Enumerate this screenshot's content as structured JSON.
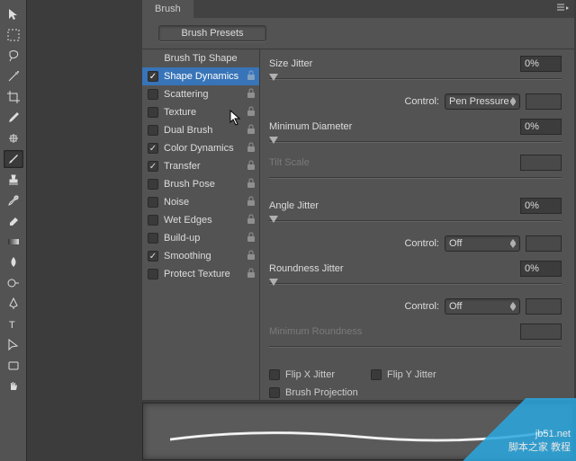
{
  "panel": {
    "title": "Brush",
    "presets_btn": "Brush Presets",
    "tip_shape": "Brush Tip Shape"
  },
  "list": [
    {
      "label": "Shape Dynamics",
      "checked": true,
      "selected": true,
      "lock": true
    },
    {
      "label": "Scattering",
      "checked": false,
      "selected": false,
      "lock": true
    },
    {
      "label": "Texture",
      "checked": false,
      "selected": false,
      "lock": true
    },
    {
      "label": "Dual Brush",
      "checked": false,
      "selected": false,
      "lock": true
    },
    {
      "label": "Color Dynamics",
      "checked": true,
      "selected": false,
      "lock": true
    },
    {
      "label": "Transfer",
      "checked": true,
      "selected": false,
      "lock": true
    },
    {
      "label": "Brush Pose",
      "checked": false,
      "selected": false,
      "lock": true
    },
    {
      "label": "Noise",
      "checked": false,
      "selected": false,
      "lock": true
    },
    {
      "label": "Wet Edges",
      "checked": false,
      "selected": false,
      "lock": true
    },
    {
      "label": "Build-up",
      "checked": false,
      "selected": false,
      "lock": true
    },
    {
      "label": "Smoothing",
      "checked": true,
      "selected": false,
      "lock": true
    },
    {
      "label": "Protect Texture",
      "checked": false,
      "selected": false,
      "lock": true
    }
  ],
  "props": {
    "size_jitter": {
      "label": "Size Jitter",
      "value": "0%"
    },
    "control1": {
      "label": "Control:",
      "value": "Pen Pressure"
    },
    "min_diameter": {
      "label": "Minimum Diameter",
      "value": "0%"
    },
    "tilt_scale": {
      "label": "Tilt Scale",
      "value": ""
    },
    "angle_jitter": {
      "label": "Angle Jitter",
      "value": "0%"
    },
    "control2": {
      "label": "Control:",
      "value": "Off"
    },
    "roundness_jitter": {
      "label": "Roundness Jitter",
      "value": "0%"
    },
    "control3": {
      "label": "Control:",
      "value": "Off"
    },
    "min_roundness": {
      "label": "Minimum Roundness",
      "value": ""
    },
    "flip_x": {
      "label": "Flip X Jitter",
      "checked": false
    },
    "flip_y": {
      "label": "Flip Y Jitter",
      "checked": false
    },
    "brush_proj": {
      "label": "Brush Projection",
      "checked": false
    }
  },
  "watermark": {
    "line1": "jb51.net",
    "line2": "脚本之家 教程"
  }
}
